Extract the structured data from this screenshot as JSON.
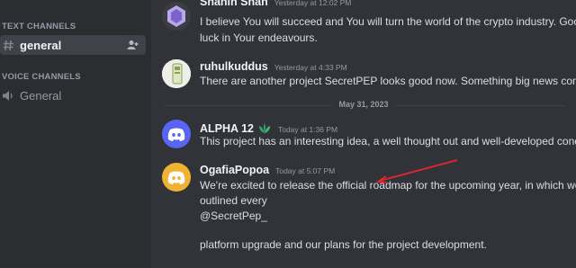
{
  "sidebar": {
    "text_channels_header": "TEXT CHANNELS",
    "voice_channels_header": "VOICE CHANNELS",
    "text_channels": [
      {
        "name": "general",
        "icon": "hash-icon"
      }
    ],
    "voice_channels": [
      {
        "name": "General",
        "icon": "speaker-icon"
      }
    ]
  },
  "messages": [
    {
      "username": "Shahin Shah",
      "timestamp": "Yesterday at 12:02 PM",
      "lines": [
        "I believe You will succeed and You will turn the world of the crypto industry. Good",
        "luck in Your endeavours."
      ]
    },
    {
      "username": "ruhulkuddus",
      "timestamp": "Yesterday at 4:33 PM",
      "lines": [
        "There are another project SecretPEP  looks good now. Something big news coming"
      ]
    },
    {
      "username": "ALPHA 12",
      "timestamp": "Today at 1:36 PM",
      "badge": "leaf-badge-icon",
      "lines": [
        "This project has an interesting idea, a well thought out and well-developed concep"
      ]
    },
    {
      "username": "OgafiaPopoa",
      "timestamp": "Today at 5:07 PM",
      "lines": [
        "We're excited to release the official roadmap for the upcoming year, in which we",
        "outlined every",
        "@SecretPep_",
        "",
        "platform upgrade and our plans for the project development."
      ]
    }
  ],
  "date_divider": "May 31, 2023",
  "colors": {
    "sidebar_bg": "#2b2d31",
    "chat_bg": "#313338",
    "discord_blurple": "#5865f2",
    "discord_orange": "#f0b232",
    "arrow_red": "#e5262e"
  }
}
